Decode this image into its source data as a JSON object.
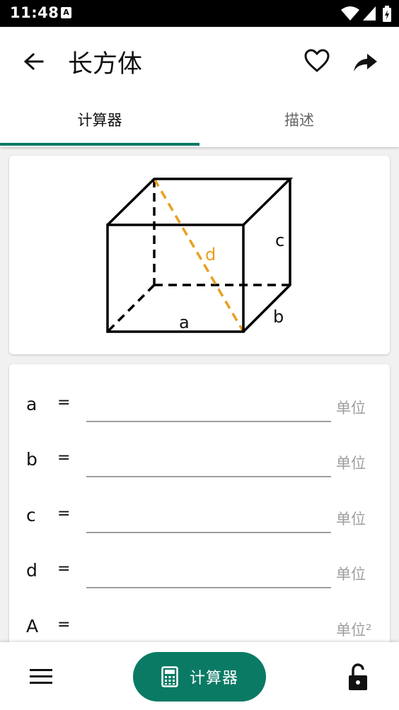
{
  "status_bar": {
    "time": "11:48",
    "notification_icon": "A"
  },
  "app_bar": {
    "title": "长方体"
  },
  "tabs": [
    {
      "label": "计算器",
      "selected": true
    },
    {
      "label": "描述",
      "selected": false
    }
  ],
  "diagram": {
    "labels": {
      "a": "a",
      "b": "b",
      "c": "c",
      "d": "d"
    },
    "highlight_color": "#e8a020"
  },
  "form": {
    "equals": "=",
    "rows": [
      {
        "var": "a",
        "value": "",
        "unit": "单位"
      },
      {
        "var": "b",
        "value": "",
        "unit": "单位"
      },
      {
        "var": "c",
        "value": "",
        "unit": "单位"
      },
      {
        "var": "d",
        "value": "",
        "unit": "单位"
      },
      {
        "var": "A",
        "value": "",
        "unit": "单位²"
      }
    ]
  },
  "bottom_bar": {
    "calculate_label": "计算器"
  },
  "colors": {
    "accent": "#0a7a64",
    "highlight": "#e8a020"
  }
}
